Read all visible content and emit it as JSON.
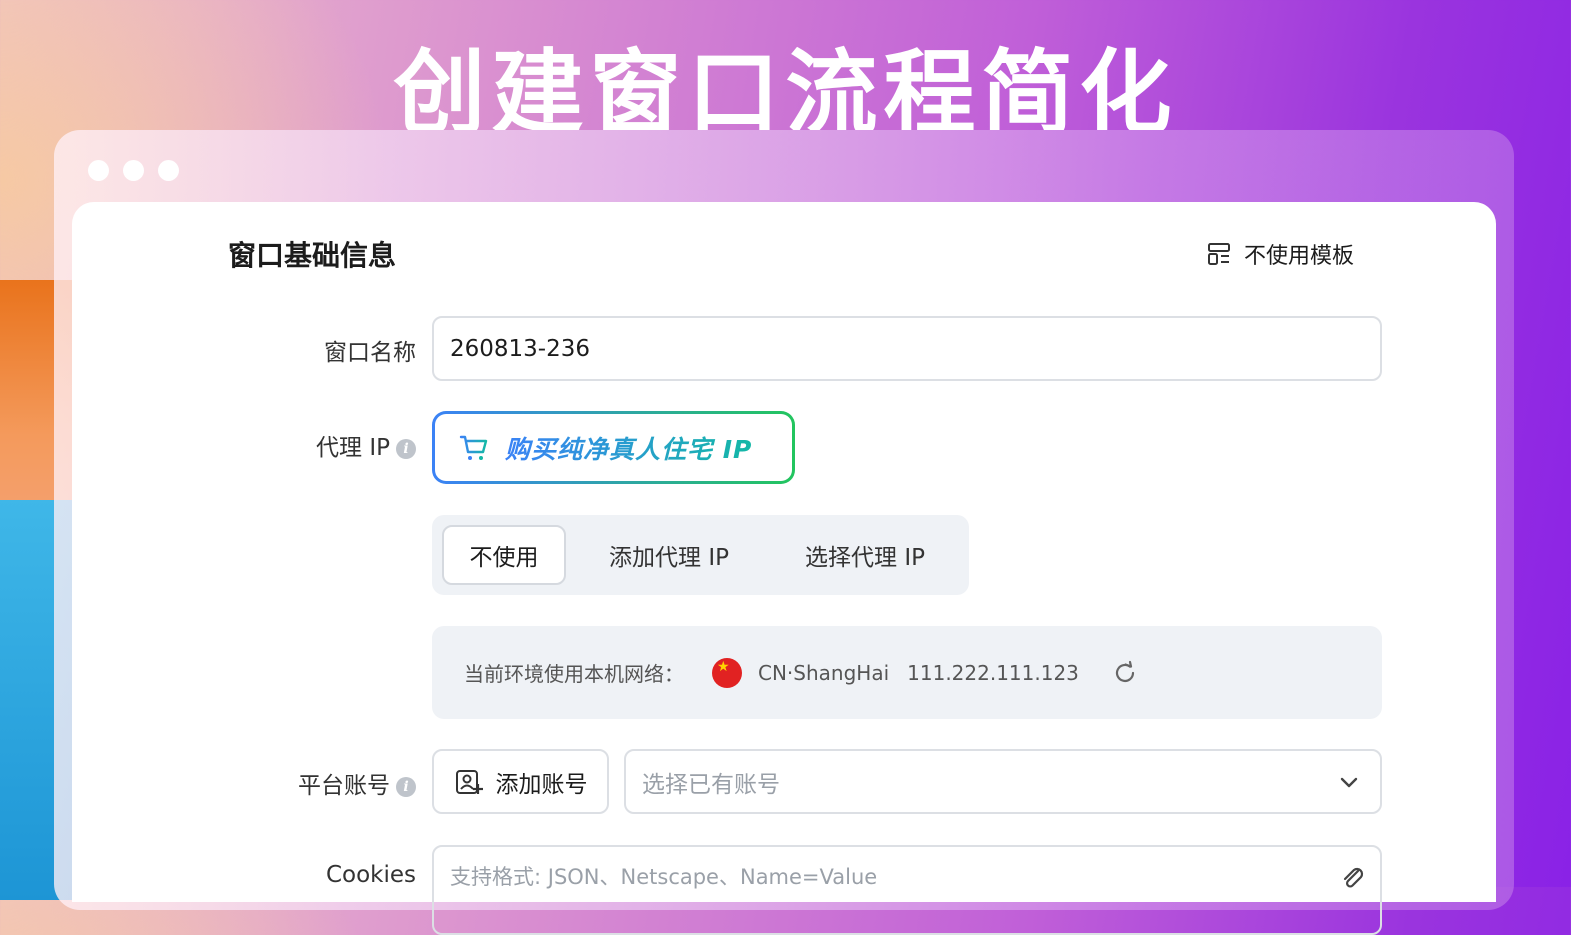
{
  "headline": "创建窗口流程简化",
  "form": {
    "section_title": "窗口基础信息",
    "template_button": "不使用模板",
    "window_name": {
      "label": "窗口名称",
      "value": "260813-236"
    },
    "proxy": {
      "label": "代理 IP",
      "info_icon": "i",
      "buy_button": "购买纯净真人住宅 IP",
      "options": [
        "不使用",
        "添加代理 IP",
        "选择代理 IP"
      ],
      "selected": "不使用",
      "network_label": "当前环境使用本机网络：",
      "location": "CN·ShangHai",
      "ip": "111.222.111.123"
    },
    "account": {
      "label": "平台账号",
      "add_button": "添加账号",
      "select_placeholder": "选择已有账号"
    },
    "cookies": {
      "label": "Cookies",
      "placeholder": "支持格式: JSON、Netscape、Name=Value"
    }
  },
  "icons": [
    "template-icon",
    "cart-icon",
    "info-icon",
    "china-flag-icon",
    "refresh-icon",
    "add-account-icon",
    "chevron-down-icon",
    "paperclip-icon"
  ],
  "colors": {
    "accent_blue": "#3b82f6",
    "accent_green": "#22c55e"
  }
}
